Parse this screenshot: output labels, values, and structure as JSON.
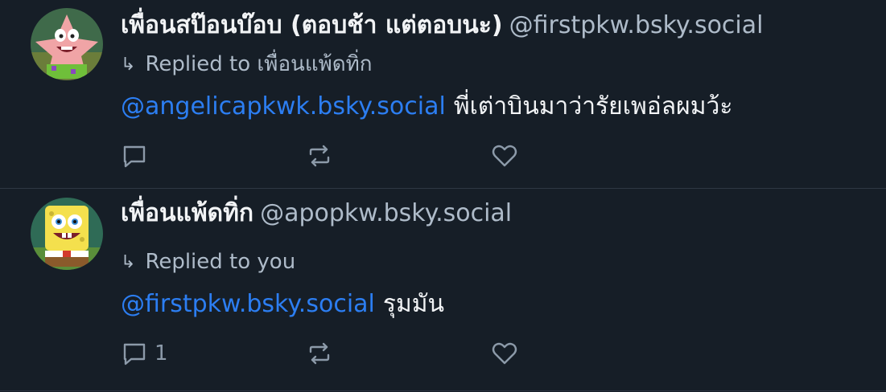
{
  "posts": [
    {
      "display_name": "เพื่อนสป๊อนบ๊อบ (ตอบช้า แต่ตอบนะ)",
      "handle": "@firstpkw.bsky.social",
      "reply_arrow": "↳",
      "reply_to": "Replied to เพื่อนแพ้ดทิ่ก",
      "mention": "@angelicapkwk.bsky.social",
      "text": "พี่เต่าบินมาว่ารัยเพอ่ลผมว้ะ",
      "reply_count": "",
      "avatar_icon": "patrick-star-avatar",
      "icons": [
        "reply-icon",
        "repost-icon",
        "like-icon"
      ]
    },
    {
      "display_name": "เพื่อนแพ้ดทิ่ก",
      "handle": "@apopkw.bsky.social",
      "reply_arrow": "↳",
      "reply_to": "Replied to you",
      "mention": "@firstpkw.bsky.social",
      "text": "รุมมัน",
      "reply_count": "1",
      "avatar_icon": "spongebob-avatar",
      "icons": [
        "reply-icon",
        "repost-icon",
        "like-icon"
      ]
    }
  ],
  "colors": {
    "background": "#161e27",
    "text": "#f1f3f5",
    "muted": "#aebbc9",
    "link": "#2c7ef2",
    "icon": "#8c9aa9",
    "divider": "#2e3843"
  }
}
